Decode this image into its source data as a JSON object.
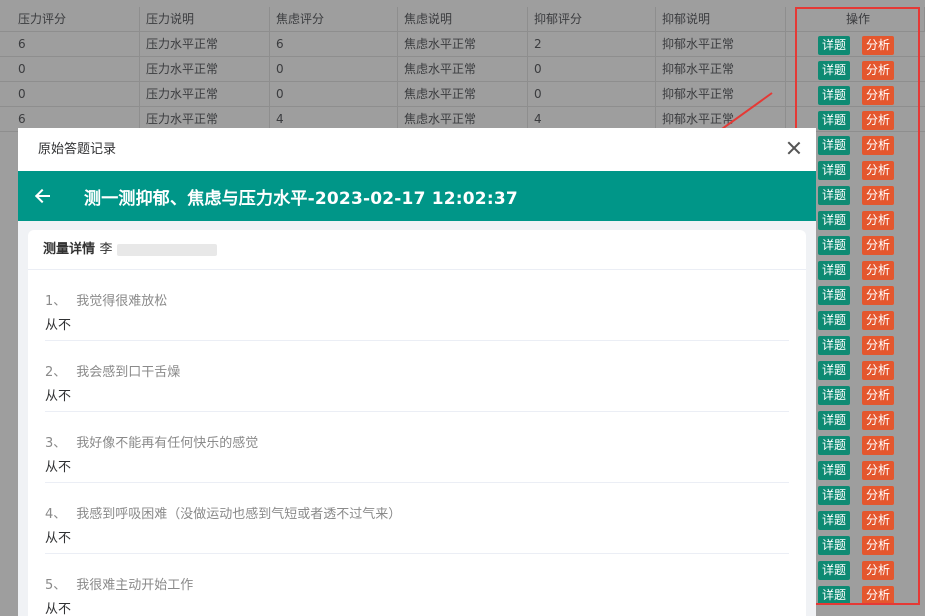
{
  "table": {
    "headers": [
      "压力评分",
      "压力说明",
      "焦虑评分",
      "焦虑说明",
      "抑郁评分",
      "抑郁说明",
      "操作"
    ],
    "rows": [
      [
        "6",
        "压力水平正常",
        "6",
        "焦虑水平正常",
        "2",
        "抑郁水平正常"
      ],
      [
        "0",
        "压力水平正常",
        "0",
        "焦虑水平正常",
        "0",
        "抑郁水平正常"
      ],
      [
        "0",
        "压力水平正常",
        "0",
        "焦虑水平正常",
        "0",
        "抑郁水平正常"
      ],
      [
        "6",
        "压力水平正常",
        "4",
        "焦虑水平正常",
        "4",
        "抑郁水平正常"
      ]
    ],
    "detail_label": "详题",
    "analyze_label": "分析"
  },
  "modal": {
    "title": "原始答题记录",
    "app_title": "测一测抑郁、焦虑与压力水平-2023-02-17 12:02:37",
    "card_header_label": "测量详情",
    "card_header_name": "李",
    "questions": [
      {
        "num": "1、",
        "text": "我觉得很难放松",
        "answer": "从不"
      },
      {
        "num": "2、",
        "text": "我会感到口干舌燥",
        "answer": "从不"
      },
      {
        "num": "3、",
        "text": "我好像不能再有任何快乐的感觉",
        "answer": "从不"
      },
      {
        "num": "4、",
        "text": "我感到呼吸困难（没做运动也感到气短或者透不过气来）",
        "answer": "从不"
      },
      {
        "num": "5、",
        "text": "我很难主动开始工作",
        "answer": "从不"
      }
    ]
  },
  "colors": {
    "teal": "#009688",
    "detail_button": "#0e8a73",
    "analyze_button": "#e4572e",
    "highlight": "#e53935"
  }
}
